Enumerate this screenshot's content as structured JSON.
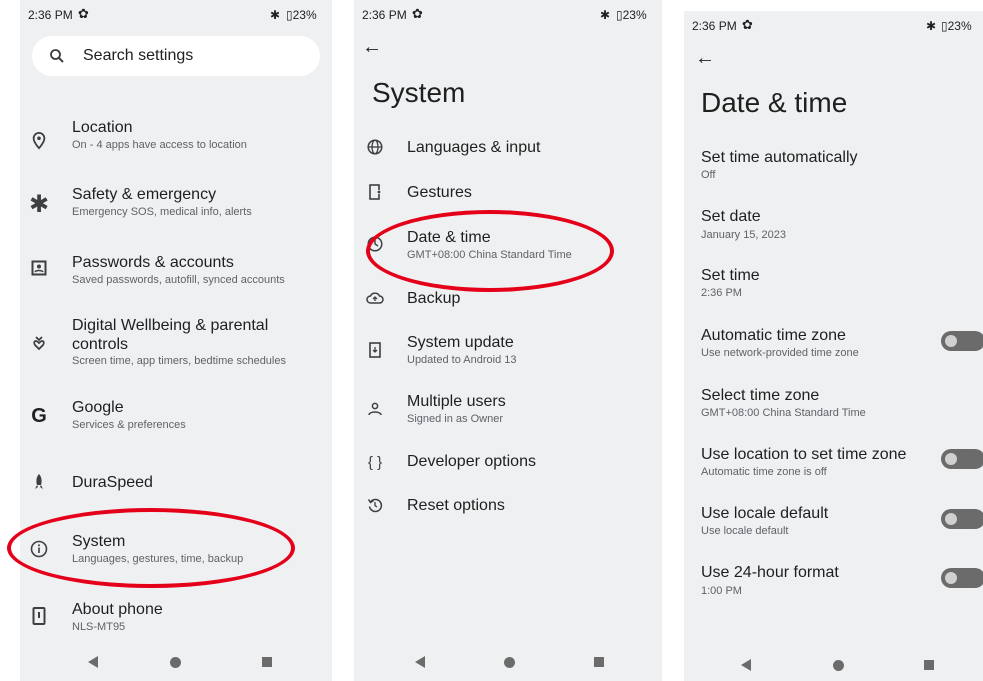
{
  "status": {
    "time": "2:36 PM",
    "battery": "23%",
    "battery_cut": "23%"
  },
  "settings": {
    "search_placeholder": "Search settings",
    "items": [
      {
        "title": "Location",
        "sub": "On - 4 apps have access to location",
        "icon": "location-pin-icon"
      },
      {
        "title": "Safety & emergency",
        "sub": "Emergency SOS, medical info, alerts",
        "icon": "asterisk-icon"
      },
      {
        "title": "Passwords & accounts",
        "sub": "Saved passwords, autofill, synced accounts",
        "icon": "account-box-icon"
      },
      {
        "title": "Digital Wellbeing & parental",
        "title2": "controls",
        "sub": "Screen time, app timers, bedtime schedules",
        "icon": "wellbeing-icon"
      },
      {
        "title": "Google",
        "sub": "Services & preferences",
        "icon": "google-icon"
      },
      {
        "title": "DuraSpeed",
        "sub": "",
        "icon": "rocket-icon"
      },
      {
        "title": "System",
        "sub": "Languages, gestures, time, backup",
        "icon": "info-icon"
      },
      {
        "title": "About phone",
        "sub": "NLS-MT95",
        "icon": "phone-icon"
      }
    ]
  },
  "system": {
    "title": "System",
    "items": [
      {
        "title": "Languages & input",
        "sub": "",
        "icon": "globe-icon"
      },
      {
        "title": "Gestures",
        "sub": "",
        "icon": "gesture-phone-icon"
      },
      {
        "title": "Date & time",
        "sub": "GMT+08:00 China Standard Time",
        "icon": "clock-icon"
      },
      {
        "title": "Backup",
        "sub": "",
        "icon": "cloud-backup-icon"
      },
      {
        "title": "System update",
        "sub": "Updated to Android 13",
        "icon": "system-update-icon"
      },
      {
        "title": "Multiple users",
        "sub": "Signed in as Owner",
        "icon": "users-icon"
      },
      {
        "title": "Developer options",
        "sub": "",
        "icon": "braces-icon"
      },
      {
        "title": "Reset options",
        "sub": "",
        "icon": "reset-icon"
      }
    ]
  },
  "datetime": {
    "title": "Date & time",
    "items": [
      {
        "title": "Set time automatically",
        "sub": "Off"
      },
      {
        "title": "Set date",
        "sub": "January 15, 2023"
      },
      {
        "title": "Set time",
        "sub": "2:36 PM"
      },
      {
        "title": "Automatic time zone",
        "sub": "Use network-provided time zone",
        "toggle": false
      },
      {
        "title": "Select time zone",
        "sub": "GMT+08:00 China Standard Time"
      },
      {
        "title": "Use location to set time zone",
        "sub": "Automatic time zone is off",
        "toggle": false
      },
      {
        "title": "Use locale default",
        "sub": "Use locale default",
        "toggle": false
      },
      {
        "title": "Use 24-hour format",
        "sub": "1:00 PM",
        "toggle": false
      }
    ]
  },
  "colors": {
    "background": "#eef0f2",
    "highlight": "#e5001a",
    "toggle_off": "#6b6b6b"
  }
}
